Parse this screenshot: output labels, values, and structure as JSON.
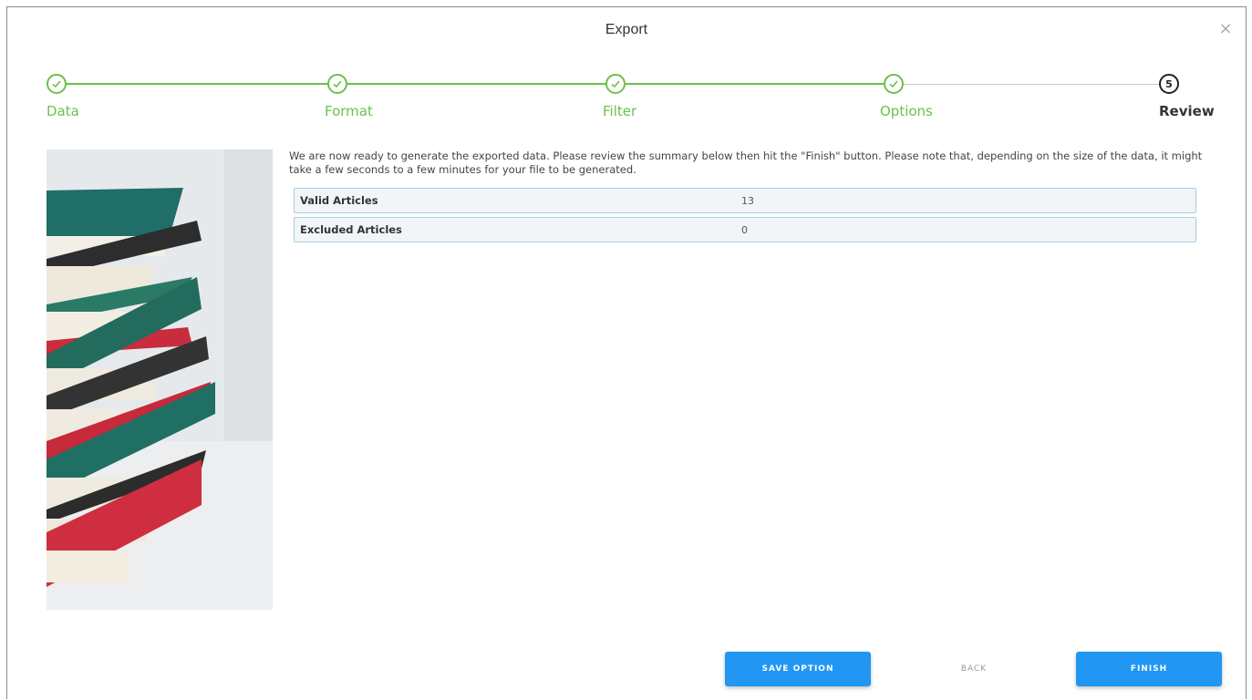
{
  "dialog": {
    "title": "Export",
    "close_symbol": "×"
  },
  "stepper": {
    "steps": [
      {
        "label": "Data",
        "status": "complete"
      },
      {
        "label": "Format",
        "status": "complete"
      },
      {
        "label": "Filter",
        "status": "complete"
      },
      {
        "label": "Options",
        "status": "complete"
      },
      {
        "label": "Review",
        "status": "current",
        "number": "5"
      }
    ]
  },
  "review": {
    "intro_text": "We are now ready to generate the exported data. Please review the summary below then hit the \"Finish\" button. Please note that, depending on the size of the data, it might take a few seconds to a few minutes for your file to be generated.",
    "rows": [
      {
        "label": "Valid Articles",
        "value": "13"
      },
      {
        "label": "Excluded Articles",
        "value": "0"
      }
    ]
  },
  "actions": {
    "save_option": "SAVE OPTION",
    "back": "BACK",
    "finish": "FINISH"
  },
  "colors": {
    "step_complete": "#6cc04a",
    "primary_button": "#2196f3"
  },
  "icons": {
    "step_complete": "checkmark-icon",
    "close": "close-icon",
    "image": "book-stack-image"
  }
}
